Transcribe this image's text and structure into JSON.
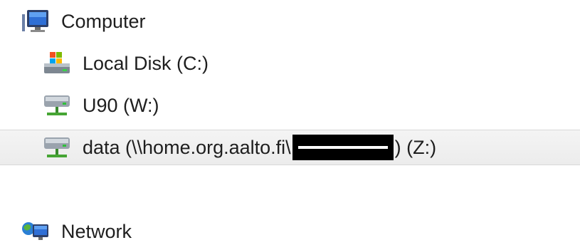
{
  "nav_tree": {
    "computer": {
      "label": "Computer",
      "icon": "computer-icon"
    },
    "drives": [
      {
        "label": "Local Disk (C:)",
        "icon": "local-disk-icon"
      },
      {
        "label": "U90 (W:)",
        "icon": "network-drive-icon"
      },
      {
        "label_prefix": "data (\\\\home.org.aalto.fi\\",
        "label_suffix": ") (Z:)",
        "icon": "network-drive-icon",
        "selected": true
      }
    ],
    "network": {
      "label": "Network",
      "icon": "network-icon"
    }
  }
}
